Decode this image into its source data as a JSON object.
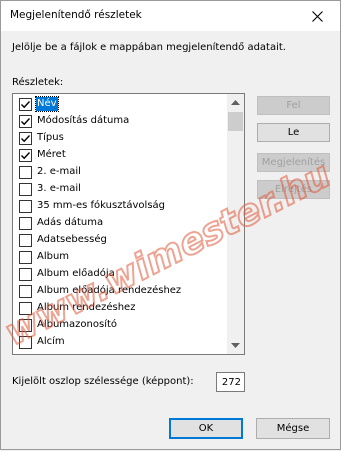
{
  "dialog": {
    "title": "Megjelenítendő részletek",
    "instruction": "Jelölje be a fájlok e mappában megjelenítendő adatait.",
    "details_label": "Részletek:",
    "items": [
      {
        "label": "Név",
        "checked": true,
        "selected": true
      },
      {
        "label": "Módosítás dátuma",
        "checked": true,
        "selected": false
      },
      {
        "label": "Típus",
        "checked": true,
        "selected": false
      },
      {
        "label": "Méret",
        "checked": true,
        "selected": false
      },
      {
        "label": "2. e-mail",
        "checked": false,
        "selected": false
      },
      {
        "label": "3. e-mail",
        "checked": false,
        "selected": false
      },
      {
        "label": "35 mm-es fókusztávolság",
        "checked": false,
        "selected": false
      },
      {
        "label": "Adás dátuma",
        "checked": false,
        "selected": false
      },
      {
        "label": "Adatsebesség",
        "checked": false,
        "selected": false
      },
      {
        "label": "Album",
        "checked": false,
        "selected": false
      },
      {
        "label": "Album előadója",
        "checked": false,
        "selected": false
      },
      {
        "label": "Album előadója rendezéshez",
        "checked": false,
        "selected": false
      },
      {
        "label": "Album rendezéshez",
        "checked": false,
        "selected": false
      },
      {
        "label": "Albumazonosító",
        "checked": false,
        "selected": false
      },
      {
        "label": "Alcím",
        "checked": false,
        "selected": false
      }
    ],
    "buttons": {
      "up": {
        "label": "Fel",
        "enabled": false
      },
      "down": {
        "label": "Le",
        "enabled": true
      },
      "show": {
        "label": "Megjelenítés",
        "enabled": false
      },
      "hide": {
        "label": "Elrejtés",
        "enabled": false
      }
    },
    "width_label": "Kijelölt oszlop szélessége (képpont):",
    "width_value": "272",
    "ok_label": "OK",
    "cancel_label": "Mégse"
  },
  "watermark": {
    "text": "www.wimester.hu",
    "color": "#e05a3c"
  },
  "colors": {
    "selection": "#0078d7",
    "dialog_bg": "#f0f0f0"
  }
}
